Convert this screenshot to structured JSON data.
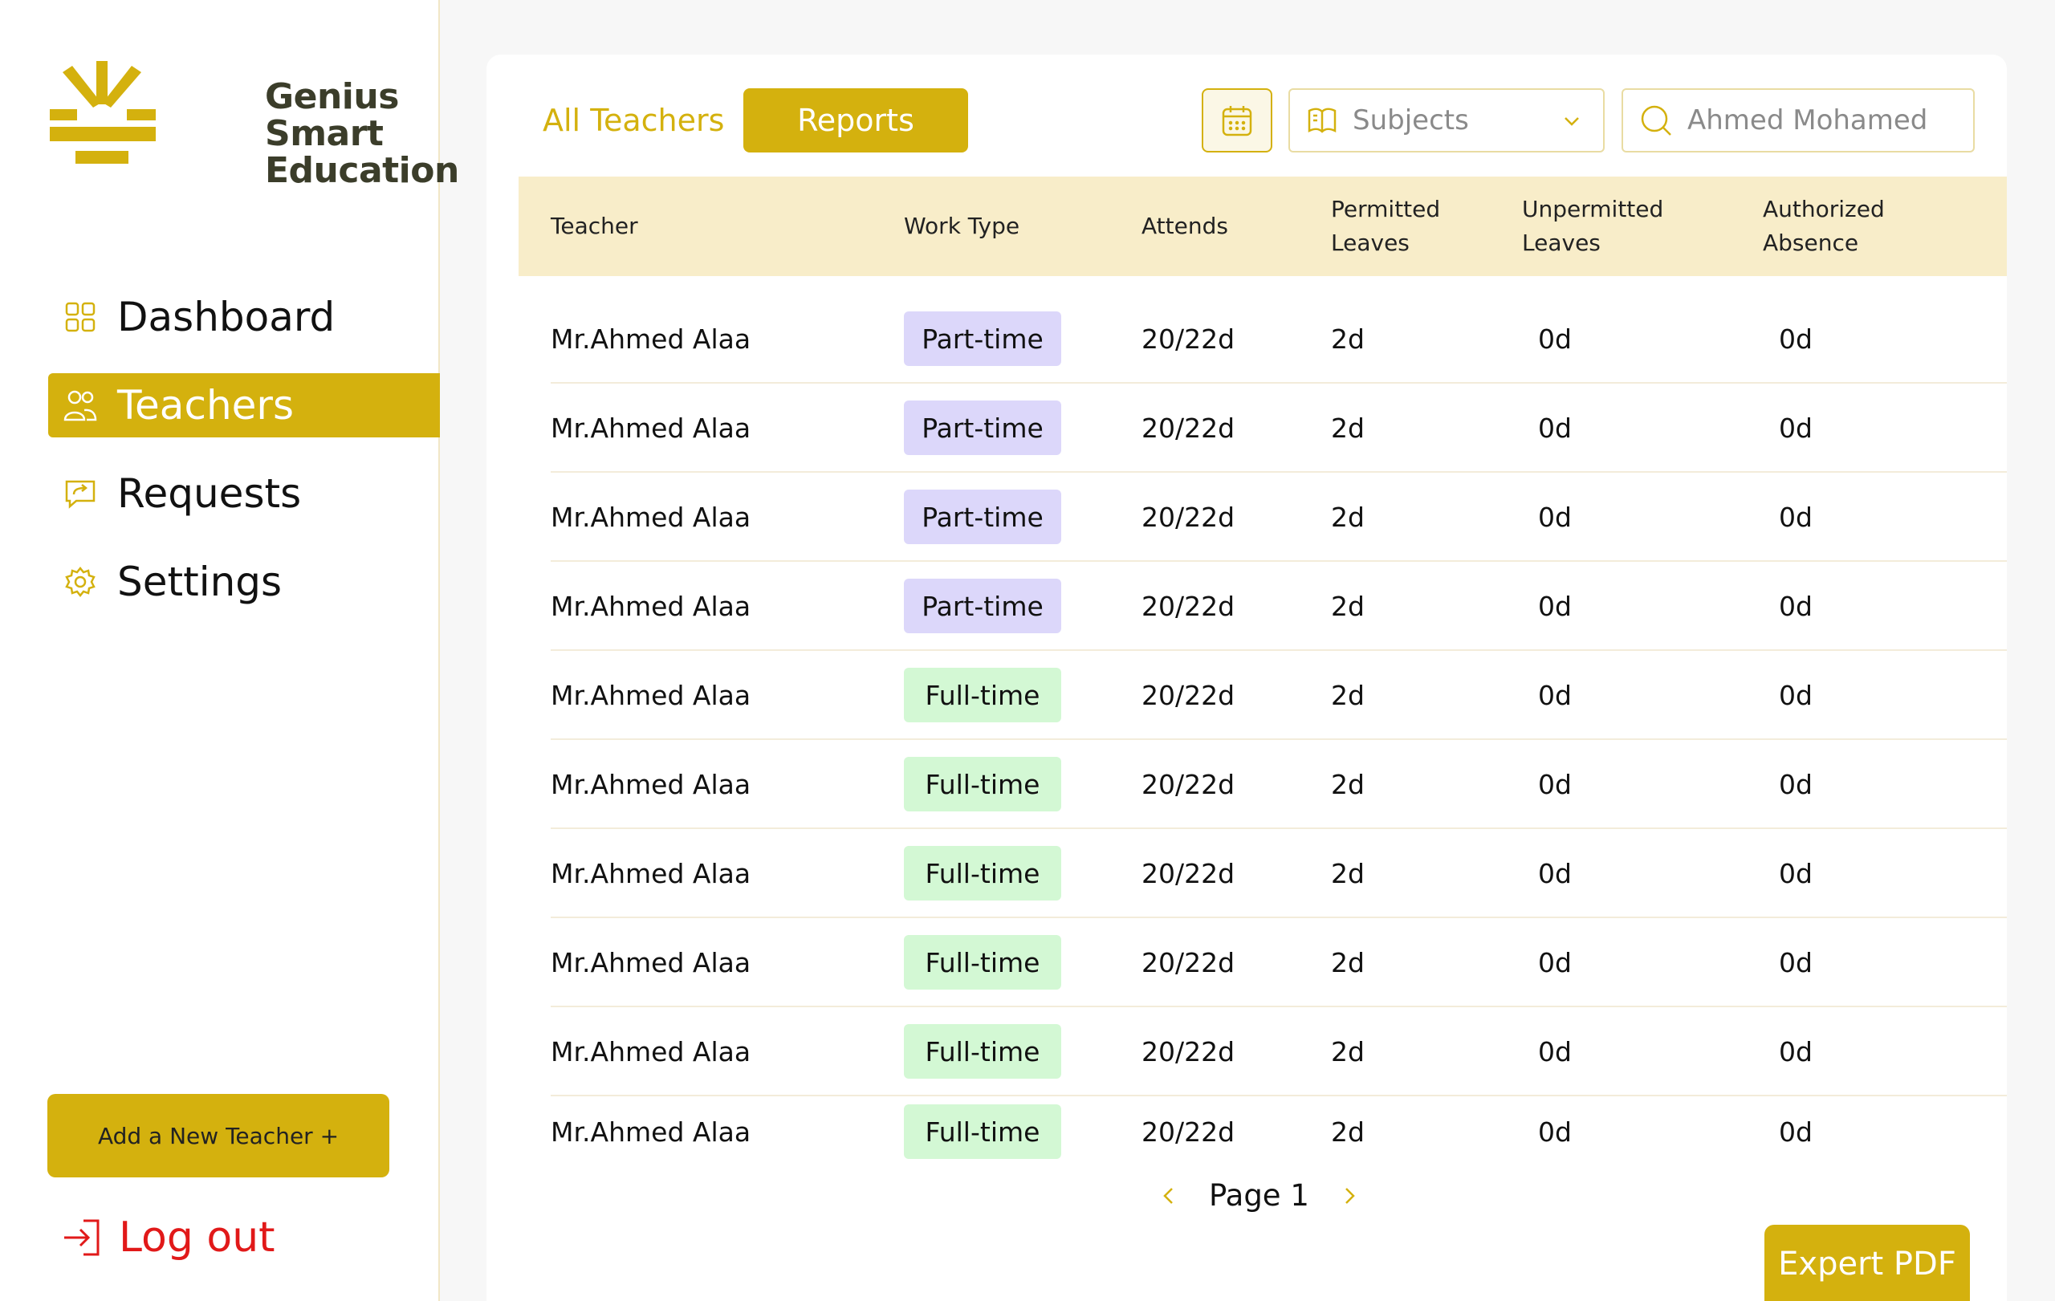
{
  "brand": {
    "line1": "Genius",
    "line2": "Smart",
    "line3": "Education",
    "accent_color": "#d4b10e"
  },
  "sidebar": {
    "items": [
      {
        "label": "Dashboard",
        "icon": "grid-icon",
        "active": false
      },
      {
        "label": "Teachers",
        "icon": "users-icon",
        "active": true
      },
      {
        "label": "Requests",
        "icon": "chat-icon",
        "active": false
      },
      {
        "label": "Settings",
        "icon": "gear-icon",
        "active": false
      }
    ],
    "add_button": "Add a New Teacher +",
    "logout": "Log out"
  },
  "toolbar": {
    "tab_all": "All Teachers",
    "tab_reports": "Reports",
    "subjects_label": "Subjects",
    "search_value": "Ahmed Mohamed"
  },
  "table": {
    "headers": {
      "teacher": "Teacher",
      "work_type": "Work Type",
      "attends": "Attends",
      "permitted_1": "Permitted",
      "permitted_2": "Leaves",
      "unpermitted_1": "Unpermitted",
      "unpermitted_2": "Leaves",
      "authorized_1": "Authorized",
      "authorized_2": "Absence"
    },
    "rows": [
      {
        "teacher": "Mr.Ahmed Alaa",
        "work_type": "Part-time",
        "attends": "20/22d",
        "permitted": "2d",
        "unpermitted": "0d",
        "authorized": "0d"
      },
      {
        "teacher": "Mr.Ahmed Alaa",
        "work_type": "Part-time",
        "attends": "20/22d",
        "permitted": "2d",
        "unpermitted": "0d",
        "authorized": "0d"
      },
      {
        "teacher": "Mr.Ahmed Alaa",
        "work_type": "Part-time",
        "attends": "20/22d",
        "permitted": "2d",
        "unpermitted": "0d",
        "authorized": "0d"
      },
      {
        "teacher": "Mr.Ahmed Alaa",
        "work_type": "Part-time",
        "attends": "20/22d",
        "permitted": "2d",
        "unpermitted": "0d",
        "authorized": "0d"
      },
      {
        "teacher": "Mr.Ahmed Alaa",
        "work_type": "Full-time",
        "attends": "20/22d",
        "permitted": "2d",
        "unpermitted": "0d",
        "authorized": "0d"
      },
      {
        "teacher": "Mr.Ahmed Alaa",
        "work_type": "Full-time",
        "attends": "20/22d",
        "permitted": "2d",
        "unpermitted": "0d",
        "authorized": "0d"
      },
      {
        "teacher": "Mr.Ahmed Alaa",
        "work_type": "Full-time",
        "attends": "20/22d",
        "permitted": "2d",
        "unpermitted": "0d",
        "authorized": "0d"
      },
      {
        "teacher": "Mr.Ahmed Alaa",
        "work_type": "Full-time",
        "attends": "20/22d",
        "permitted": "2d",
        "unpermitted": "0d",
        "authorized": "0d"
      },
      {
        "teacher": "Mr.Ahmed Alaa",
        "work_type": "Full-time",
        "attends": "20/22d",
        "permitted": "2d",
        "unpermitted": "0d",
        "authorized": "0d"
      },
      {
        "teacher": "Mr.Ahmed Alaa",
        "work_type": "Full-time",
        "attends": "20/22d",
        "permitted": "2d",
        "unpermitted": "0d",
        "authorized": "0d"
      }
    ]
  },
  "pagination": {
    "label": "Page 1"
  },
  "export_button": "Expert PDF"
}
